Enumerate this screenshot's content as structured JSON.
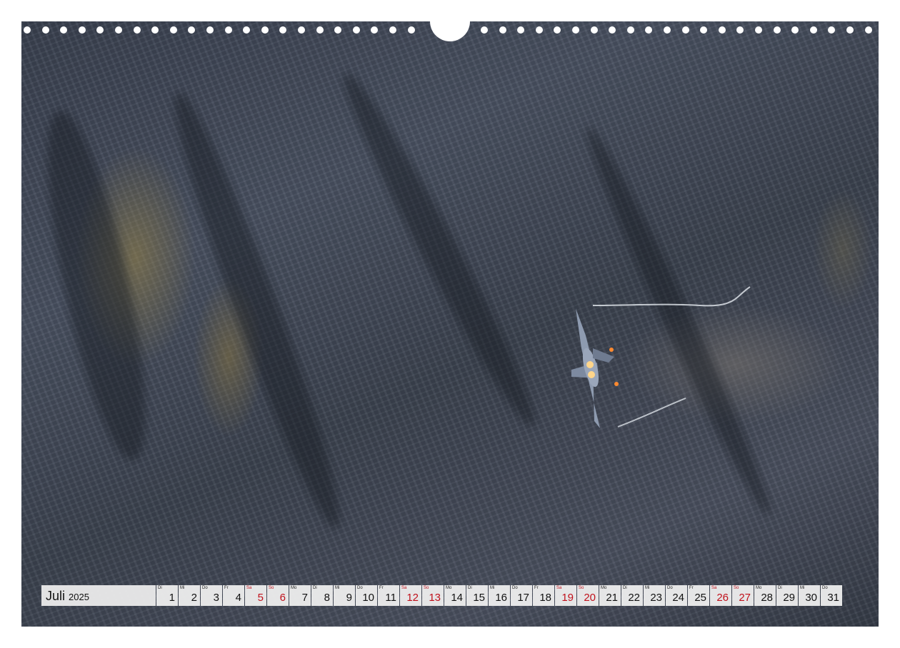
{
  "calendar": {
    "month": "Juli",
    "year": "2025",
    "days": [
      {
        "abbr": "Di",
        "num": "1",
        "weekend": false
      },
      {
        "abbr": "Mi",
        "num": "2",
        "weekend": false
      },
      {
        "abbr": "Do",
        "num": "3",
        "weekend": false
      },
      {
        "abbr": "Fr",
        "num": "4",
        "weekend": false
      },
      {
        "abbr": "Sa",
        "num": "5",
        "weekend": true
      },
      {
        "abbr": "So",
        "num": "6",
        "weekend": true
      },
      {
        "abbr": "Mo",
        "num": "7",
        "weekend": false
      },
      {
        "abbr": "Di",
        "num": "8",
        "weekend": false
      },
      {
        "abbr": "Mi",
        "num": "9",
        "weekend": false
      },
      {
        "abbr": "Do",
        "num": "10",
        "weekend": false
      },
      {
        "abbr": "Fr",
        "num": "11",
        "weekend": false
      },
      {
        "abbr": "Sa",
        "num": "12",
        "weekend": true
      },
      {
        "abbr": "So",
        "num": "13",
        "weekend": true
      },
      {
        "abbr": "Mo",
        "num": "14",
        "weekend": false
      },
      {
        "abbr": "Di",
        "num": "15",
        "weekend": false
      },
      {
        "abbr": "Mi",
        "num": "16",
        "weekend": false
      },
      {
        "abbr": "Do",
        "num": "17",
        "weekend": false
      },
      {
        "abbr": "Fr",
        "num": "18",
        "weekend": false
      },
      {
        "abbr": "Sa",
        "num": "19",
        "weekend": true
      },
      {
        "abbr": "So",
        "num": "20",
        "weekend": true
      },
      {
        "abbr": "Mo",
        "num": "21",
        "weekend": false
      },
      {
        "abbr": "Di",
        "num": "22",
        "weekend": false
      },
      {
        "abbr": "Mi",
        "num": "23",
        "weekend": false
      },
      {
        "abbr": "Do",
        "num": "24",
        "weekend": false
      },
      {
        "abbr": "Fr",
        "num": "25",
        "weekend": false
      },
      {
        "abbr": "Sa",
        "num": "26",
        "weekend": true
      },
      {
        "abbr": "So",
        "num": "27",
        "weekend": true
      },
      {
        "abbr": "Mo",
        "num": "28",
        "weekend": false
      },
      {
        "abbr": "Di",
        "num": "29",
        "weekend": false
      },
      {
        "abbr": "Mi",
        "num": "30",
        "weekend": false
      },
      {
        "abbr": "Do",
        "num": "31",
        "weekend": false
      }
    ]
  },
  "colors": {
    "weekend": "#c0111b",
    "cell_background": "#eeeeee",
    "rock": "#3f4655"
  },
  "photo": {
    "icons": [
      "jet-aircraft-icon",
      "afterburner-icon",
      "contrail-icon"
    ]
  }
}
